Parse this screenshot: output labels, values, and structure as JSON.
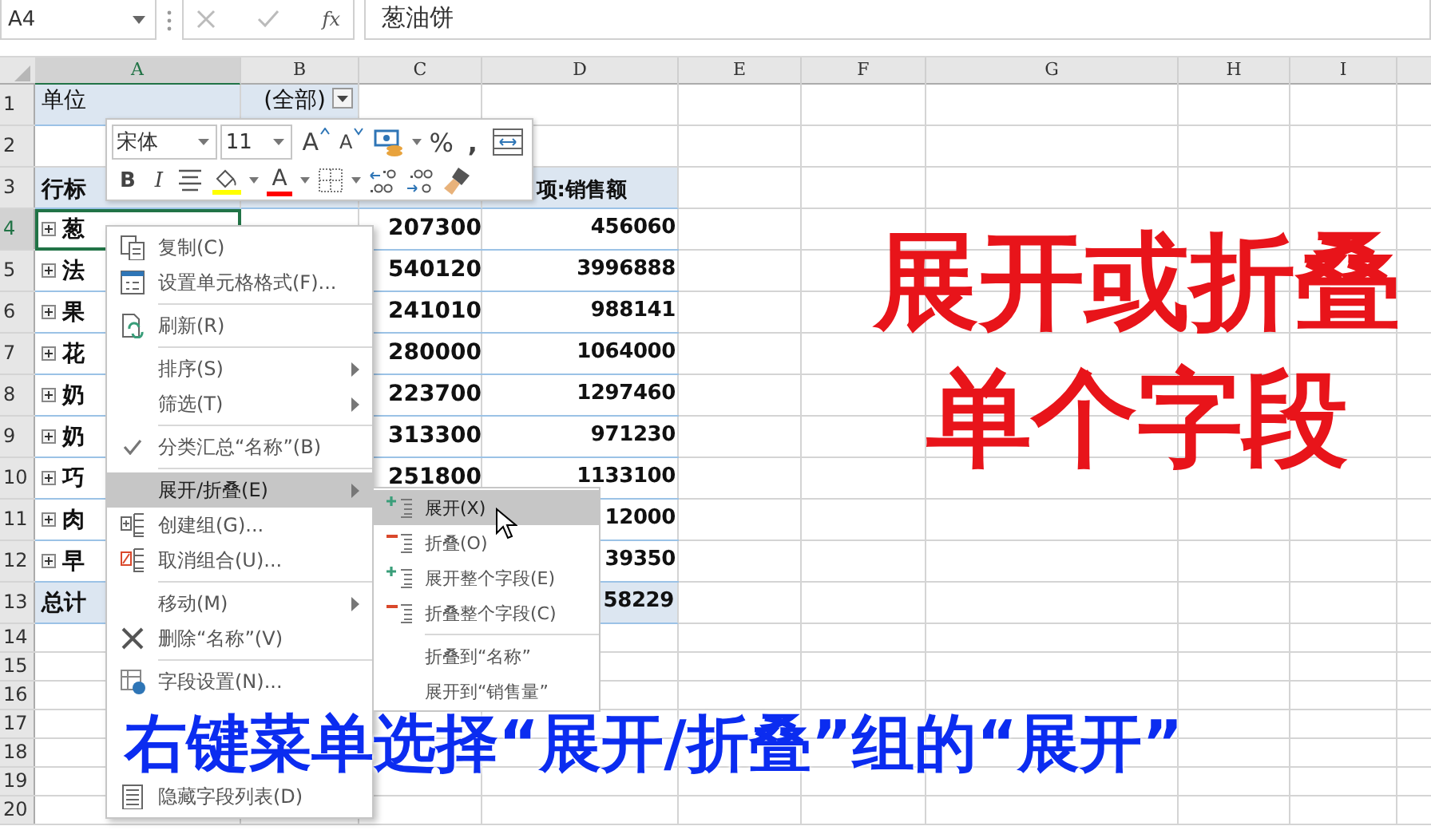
{
  "formula_bar": {
    "name_box": "A4",
    "function_label": "fx",
    "formula": "葱油饼"
  },
  "sheet": {
    "columns": [
      {
        "label": "A",
        "selected": true
      },
      {
        "label": "B",
        "selected": false
      },
      {
        "label": "C",
        "selected": false
      },
      {
        "label": "D",
        "selected": false
      },
      {
        "label": "E",
        "selected": false
      },
      {
        "label": "F",
        "selected": false
      },
      {
        "label": "G",
        "selected": false
      },
      {
        "label": "H",
        "selected": false
      },
      {
        "label": "I",
        "selected": false
      }
    ],
    "rows": [
      {
        "header": "1",
        "kind": "filter",
        "selected": false,
        "cells": {
          "a": "单位",
          "b": "(全部)"
        }
      },
      {
        "header": "2",
        "kind": "blank",
        "selected": false,
        "cells": {}
      },
      {
        "header": "3",
        "kind": "pivot-header",
        "selected": false,
        "cells": {
          "a": "行标",
          "d": "项:销售额"
        }
      },
      {
        "header": "4",
        "kind": "item",
        "selected": true,
        "cells": {
          "a": "葱",
          "c": "207300",
          "d": "456060"
        }
      },
      {
        "header": "5",
        "kind": "item",
        "selected": false,
        "cells": {
          "a": "法",
          "c": "540120",
          "d": "3996888"
        }
      },
      {
        "header": "6",
        "kind": "item",
        "selected": false,
        "cells": {
          "a": "果",
          "c": "241010",
          "d": "988141"
        }
      },
      {
        "header": "7",
        "kind": "item",
        "selected": false,
        "cells": {
          "a": "花",
          "c": "280000",
          "d": "1064000"
        }
      },
      {
        "header": "8",
        "kind": "item",
        "selected": false,
        "cells": {
          "a": "奶",
          "c": "223700",
          "d": "1297460"
        }
      },
      {
        "header": "9",
        "kind": "item",
        "selected": false,
        "cells": {
          "a": "奶",
          "c": "313300",
          "d": "971230"
        }
      },
      {
        "header": "10",
        "kind": "item",
        "selected": false,
        "cells": {
          "a": "巧",
          "c": "251800",
          "d": "1133100"
        }
      },
      {
        "header": "11",
        "kind": "item",
        "selected": false,
        "cells": {
          "a": "肉",
          "d": "12000"
        }
      },
      {
        "header": "12",
        "kind": "item",
        "selected": false,
        "cells": {
          "a": "早",
          "d": "39350"
        }
      },
      {
        "header": "13",
        "kind": "total",
        "selected": false,
        "cells": {
          "a": "总计",
          "d": "58229"
        }
      },
      {
        "header": "14",
        "kind": "blank",
        "selected": false,
        "cells": {}
      },
      {
        "header": "15",
        "kind": "blank",
        "selected": false,
        "cells": {}
      },
      {
        "header": "16",
        "kind": "blank",
        "selected": false,
        "cells": {}
      },
      {
        "header": "17",
        "kind": "blank",
        "selected": false,
        "cells": {}
      },
      {
        "header": "18",
        "kind": "blank",
        "selected": false,
        "cells": {}
      },
      {
        "header": "19",
        "kind": "blank",
        "selected": false,
        "cells": {}
      },
      {
        "header": "20",
        "kind": "blank",
        "selected": false,
        "cells": {}
      }
    ]
  },
  "mini_toolbar": {
    "font": "宋体",
    "size": "11",
    "rows": [
      [
        {
          "kind": "grow-font",
          "text": "A"
        },
        {
          "kind": "shrink-font",
          "text": "A"
        },
        {
          "kind": "accounting"
        },
        {
          "kind": "percent",
          "text": "%"
        },
        {
          "kind": "comma",
          "text": ","
        },
        {
          "kind": "wrap"
        }
      ],
      [
        {
          "kind": "bold",
          "text": "B"
        },
        {
          "kind": "italic",
          "text": "I"
        },
        {
          "kind": "align"
        },
        {
          "kind": "fill"
        },
        {
          "kind": "font-color",
          "text": "A"
        },
        {
          "kind": "border"
        },
        {
          "kind": "increase-decimal"
        },
        {
          "kind": "decrease-decimal"
        },
        {
          "kind": "painter"
        }
      ]
    ]
  },
  "context_menu": {
    "items": [
      {
        "label": "复制(C)",
        "kind": "copy",
        "submenu": false,
        "checked": false,
        "selected": false,
        "separator_after": false
      },
      {
        "label": "设置单元格格式(F)...",
        "kind": "format",
        "submenu": false,
        "checked": false,
        "selected": false,
        "separator_after": true
      },
      {
        "label": "刷新(R)",
        "kind": "refresh",
        "submenu": false,
        "checked": false,
        "selected": false,
        "separator_after": true
      },
      {
        "label": "排序(S)",
        "kind": "plain",
        "submenu": true,
        "checked": false,
        "selected": false,
        "separator_after": false
      },
      {
        "label": "筛选(T)",
        "kind": "plain",
        "submenu": true,
        "checked": false,
        "selected": false,
        "separator_after": true
      },
      {
        "label": "分类汇总“名称”(B)",
        "kind": "plain",
        "submenu": false,
        "checked": true,
        "selected": false,
        "separator_after": true
      },
      {
        "label": "展开/折叠(E)",
        "kind": "plain",
        "submenu": true,
        "checked": false,
        "selected": true,
        "separator_after": false
      },
      {
        "label": "创建组(G)...",
        "kind": "group",
        "submenu": false,
        "checked": false,
        "selected": false,
        "separator_after": false
      },
      {
        "label": "取消组合(U)...",
        "kind": "ungroup",
        "submenu": false,
        "checked": false,
        "selected": false,
        "separator_after": true
      },
      {
        "label": "移动(M)",
        "kind": "plain",
        "submenu": true,
        "checked": false,
        "selected": false,
        "separator_after": false
      },
      {
        "label": "删除“名称”(V)",
        "kind": "delete",
        "submenu": false,
        "checked": false,
        "selected": false,
        "separator_after": true
      },
      {
        "label": "字段设置(N)...",
        "kind": "settings",
        "submenu": false,
        "checked": false,
        "selected": false,
        "separator_after": false
      },
      {
        "label": "隐藏字段列表(D)",
        "kind": "field-list",
        "submenu": false,
        "checked": false,
        "selected": false,
        "separator_after": false
      }
    ]
  },
  "submenu": {
    "items": [
      {
        "label": "展开(X)",
        "kind": "expand",
        "selected": true,
        "separator_after": false
      },
      {
        "label": "折叠(O)",
        "kind": "collapse",
        "selected": false,
        "separator_after": false
      },
      {
        "label": "展开整个字段(E)",
        "kind": "expand",
        "selected": false,
        "separator_after": false
      },
      {
        "label": "折叠整个字段(C)",
        "kind": "collapse",
        "selected": false,
        "separator_after": true
      },
      {
        "label": "折叠到“名称”",
        "kind": "plain",
        "selected": false,
        "separator_after": false
      },
      {
        "label": "展开到“销售量”",
        "kind": "plain",
        "selected": false,
        "separator_after": false
      }
    ]
  },
  "title_overlay": [
    "展开或折叠",
    "单个字段"
  ],
  "caption": "右键菜单选择“展开/折叠”组的“展开”"
}
